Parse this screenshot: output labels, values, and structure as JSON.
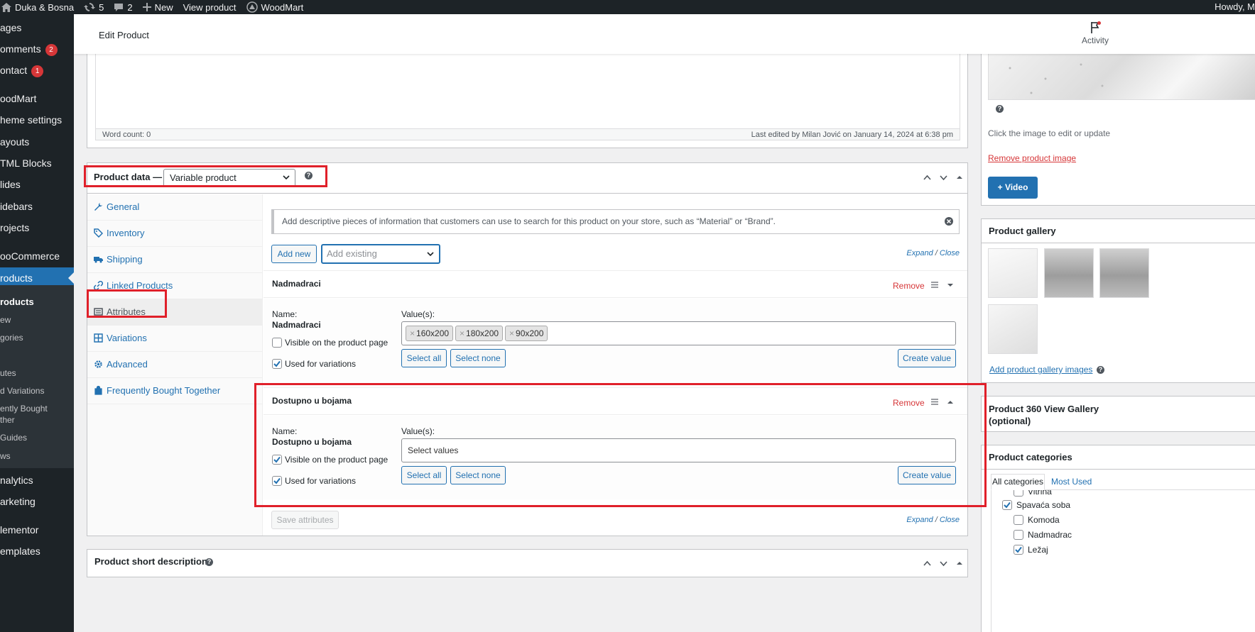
{
  "admin_bar": {
    "site_name": "Duka & Bosna",
    "updates_count": "5",
    "comments_count": "2",
    "new_label": "New",
    "view_product_label": "View product",
    "woodmart_label": "WoodMart",
    "howdy": "Howdy, M"
  },
  "sidebar": {
    "items": [
      {
        "label": "ages"
      },
      {
        "label": "omments",
        "badge": "2"
      },
      {
        "label": "ontact",
        "badge": "1"
      },
      {
        "label": "oodMart"
      },
      {
        "label": "heme settings"
      },
      {
        "label": "ayouts"
      },
      {
        "label": "TML Blocks"
      },
      {
        "label": "lides"
      },
      {
        "label": "idebars"
      },
      {
        "label": "rojects"
      },
      {
        "label": "ooCommerce"
      },
      {
        "label": "roducts"
      },
      {
        "label": "nalytics"
      },
      {
        "label": "arketing"
      },
      {
        "label": "lementor"
      },
      {
        "label": "emplates"
      }
    ],
    "submenu": [
      {
        "label": "roducts"
      },
      {
        "label": "ew"
      },
      {
        "label": "gories"
      },
      {
        "label": "utes"
      },
      {
        "label": "d Variations"
      },
      {
        "label": "ently Bought"
      },
      {
        "label": "ther"
      },
      {
        "label": "Guides"
      },
      {
        "label": "ws"
      }
    ]
  },
  "header": {
    "title": "Edit Product",
    "activity_label": "Activity"
  },
  "editor": {
    "word_count": "Word count: 0",
    "last_edited": "Last edited by Milan Jović on January 14, 2024 at 6:38 pm"
  },
  "product_data": {
    "label": "Product data —",
    "type_selected": "Variable product",
    "help": "?",
    "tabs": [
      {
        "label": "General",
        "icon": "wrench-icon"
      },
      {
        "label": "Inventory",
        "icon": "tag-icon"
      },
      {
        "label": "Shipping",
        "icon": "truck-icon"
      },
      {
        "label": "Linked Products",
        "icon": "link-icon"
      },
      {
        "label": "Attributes",
        "icon": "list-icon"
      },
      {
        "label": "Variations",
        "icon": "grid-icon"
      },
      {
        "label": "Advanced",
        "icon": "gear-icon"
      },
      {
        "label": "Frequently Bought Together",
        "icon": "bag-icon"
      }
    ],
    "active_tab": "Attributes",
    "notice": "Add descriptive pieces of information that customers can use to search for this product on your store, such as “Material” or “Brand”.",
    "add_new_label": "Add new",
    "add_existing_placeholder": "Add existing",
    "expand_label": "Expand",
    "close_label": "Close",
    "save_attributes_label": "Save attributes",
    "attributes": [
      {
        "title": "Nadmadraci",
        "remove_label": "Remove",
        "name_label": "Name:",
        "name_value": "Nadmadraci",
        "values_label": "Value(s):",
        "values": [
          "160x200",
          "180x200",
          "90x200"
        ],
        "values_placeholder": "",
        "visible_label": "Visible on the product page",
        "visible_checked": false,
        "variations_label": "Used for variations",
        "variations_checked": true,
        "select_all_label": "Select all",
        "select_none_label": "Select none",
        "create_value_label": "Create value"
      },
      {
        "title": "Dostupno u bojama",
        "remove_label": "Remove",
        "name_label": "Name:",
        "name_value": "Dostupno u bojama",
        "values_label": "Value(s):",
        "values": [],
        "values_placeholder": "Select values",
        "visible_label": "Visible on the product page",
        "visible_checked": true,
        "variations_label": "Used for variations",
        "variations_checked": true,
        "select_all_label": "Select all",
        "select_none_label": "Select none",
        "create_value_label": "Create value"
      }
    ]
  },
  "short_description": {
    "title": "Product short description"
  },
  "product_image": {
    "hint": "Click the image to edit or update",
    "remove_label": "Remove product image",
    "video_label": "Video"
  },
  "product_gallery": {
    "title": "Product gallery",
    "add_label": "Add product gallery images"
  },
  "product_360": {
    "title": "Product 360 View Gallery (optional)"
  },
  "product_categories": {
    "title": "Product categories",
    "tab_all": "All categories",
    "tab_most_used": "Most Used",
    "items": [
      {
        "label": "Vitrina",
        "checked": false,
        "level": 1
      },
      {
        "label": "Spavaća soba",
        "checked": true,
        "level": 0
      },
      {
        "label": "Komoda",
        "checked": false,
        "level": 1
      },
      {
        "label": "Nadmadrac",
        "checked": false,
        "level": 1
      },
      {
        "label": "Ležaj",
        "checked": true,
        "level": 1
      }
    ]
  },
  "colors": {
    "admin_dark": "#1d2327",
    "accent": "#2271b1",
    "danger": "#d63638",
    "highlight_box": "#e0202a"
  }
}
